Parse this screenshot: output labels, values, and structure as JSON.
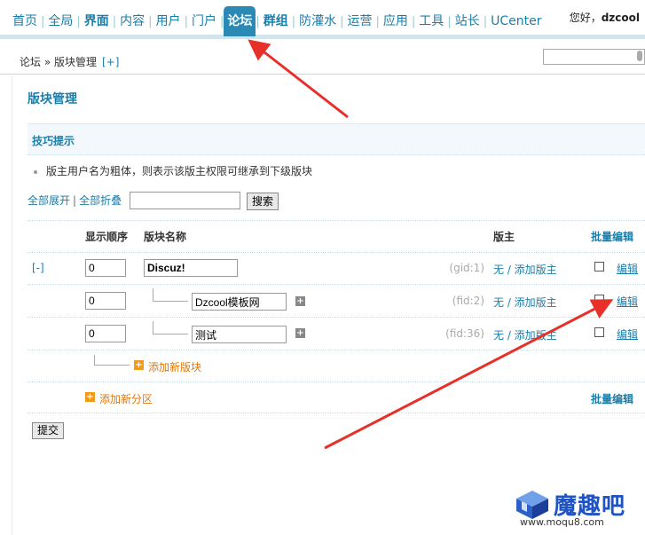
{
  "nav": {
    "items": [
      {
        "label": "首页",
        "bold": false,
        "active": false
      },
      {
        "label": "全局",
        "bold": false,
        "active": false
      },
      {
        "label": "界面",
        "bold": true,
        "active": false
      },
      {
        "label": "内容",
        "bold": false,
        "active": false
      },
      {
        "label": "用户",
        "bold": false,
        "active": false
      },
      {
        "label": "门户",
        "bold": false,
        "active": false
      },
      {
        "label": "论坛",
        "bold": true,
        "active": true
      },
      {
        "label": "群组",
        "bold": true,
        "active": false
      },
      {
        "label": "防灌水",
        "bold": false,
        "active": false
      },
      {
        "label": "运营",
        "bold": false,
        "active": false
      },
      {
        "label": "应用",
        "bold": false,
        "active": false
      },
      {
        "label": "工具",
        "bold": false,
        "active": false
      },
      {
        "label": "站长",
        "bold": false,
        "active": false
      },
      {
        "label": "UCenter",
        "bold": false,
        "active": false
      }
    ],
    "greeting": "您好，",
    "username": "dzcool"
  },
  "breadcrumb": {
    "text": "论坛 » 版块管理",
    "add": "[+]"
  },
  "page": {
    "title": "版块管理",
    "tips_title": "技巧提示",
    "tip": "版主用户名为粗体，则表示该版主权限可继承到下级版块",
    "expand_all": "全部展开",
    "separator": "|",
    "collapse_all": "全部折叠",
    "search_value": "",
    "search_button": "搜索"
  },
  "table": {
    "headers": {
      "order": "显示顺序",
      "name": "版块名称",
      "moderator": "版主",
      "batch_edit": "批量编辑"
    },
    "group_toggle": "[-]",
    "rows": [
      {
        "order": "0",
        "name": "Discuz!",
        "id": "(gid:1)",
        "moderator": "无 / 添加版主",
        "edit": "编辑"
      },
      {
        "order": "0",
        "name": "Dzcool模板网",
        "id": "(fid:2)",
        "moderator": "无 / 添加版主",
        "edit": "编辑"
      },
      {
        "order": "0",
        "name": "测试",
        "id": "(fid:36)",
        "moderator": "无 / 添加版主",
        "edit": "编辑"
      }
    ],
    "add_forum": "添加新版块",
    "add_category": "添加新分区",
    "batch_edit_bottom": "批量编辑",
    "submit": "提交"
  },
  "watermark": {
    "name": "魔趣吧",
    "url": "www.moqu8.com"
  },
  "colors": {
    "accent": "#1a7eaa",
    "active_tab": "#2a8ab5",
    "add_orange": "#f39a19",
    "arrow_red": "#e8302a"
  }
}
